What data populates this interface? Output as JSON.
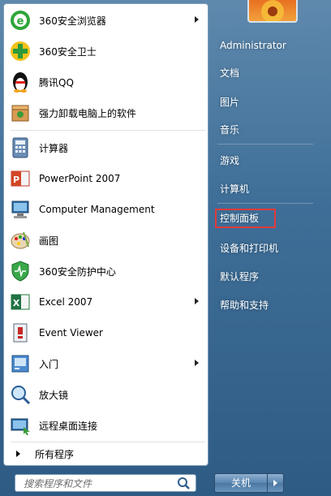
{
  "colors": {
    "highlight_box": "#e23a3a",
    "right_pane_text": "#ffffff"
  },
  "pinned": [
    {
      "label": "360安全浏览器",
      "icon": "360-browser-icon",
      "has_submenu": true
    },
    {
      "label": "360安全卫士",
      "icon": "360-security-guard-icon",
      "has_submenu": false
    },
    {
      "label": "腾讯QQ",
      "icon": "qq-penguin-icon",
      "has_submenu": false
    },
    {
      "label": "强力卸载电脑上的软件",
      "icon": "uninstall-box-icon",
      "has_submenu": false
    }
  ],
  "recent": [
    {
      "label": "计算器",
      "icon": "calculator-icon",
      "has_submenu": false
    },
    {
      "label": "PowerPoint 2007",
      "icon": "powerpoint-icon",
      "has_submenu": false
    },
    {
      "label": "Computer Management",
      "icon": "computer-management-icon",
      "has_submenu": false
    },
    {
      "label": "画图",
      "icon": "paint-palette-icon",
      "has_submenu": false
    },
    {
      "label": "360安全防护中心",
      "icon": "360-protection-shield-icon",
      "has_submenu": false
    },
    {
      "label": "Excel 2007",
      "icon": "excel-icon",
      "has_submenu": true
    },
    {
      "label": "Event Viewer",
      "icon": "event-viewer-icon",
      "has_submenu": false
    },
    {
      "label": "入门",
      "icon": "getting-started-icon",
      "has_submenu": true
    },
    {
      "label": "放大镜",
      "icon": "magnifier-icon",
      "has_submenu": false
    },
    {
      "label": "远程桌面连接",
      "icon": "remote-desktop-icon",
      "has_submenu": false
    }
  ],
  "all_programs": "所有程序",
  "search": {
    "placeholder": "搜索程序和文件"
  },
  "right": {
    "user": "Administrator",
    "documents": "文档",
    "pictures": "图片",
    "music": "音乐",
    "games": "游戏",
    "computer": "计算机",
    "control_panel": "控制面板",
    "devices_printers": "设备和打印机",
    "default_programs": "默认程序",
    "help_support": "帮助和支持"
  },
  "shutdown": {
    "label": "关机"
  }
}
